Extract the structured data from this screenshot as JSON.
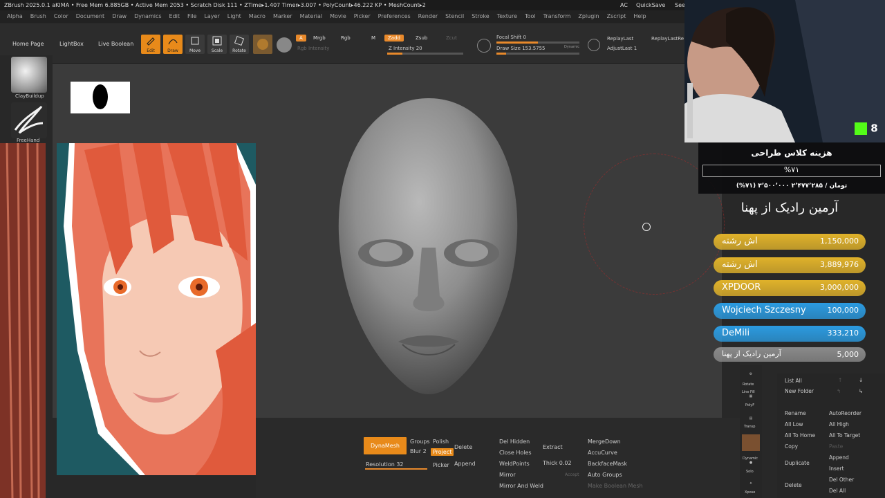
{
  "title_bar": {
    "text": "ZBrush 2025.0.1   aKIMA   • Free Mem 6.885GB • Active Mem 2053 • Scratch Disk 111 • ZTime▸1.407 Timer▸3.007 • PolyCount▸46.222 KP • MeshCount▸2",
    "ac": "AC",
    "quicksave": "QuickSave",
    "see": "See"
  },
  "menu": [
    "Alpha",
    "Brush",
    "Color",
    "Document",
    "Draw",
    "Dynamics",
    "Edit",
    "File",
    "Layer",
    "Light",
    "Macro",
    "Marker",
    "Material",
    "Movie",
    "Picker",
    "Preferences",
    "Render",
    "Stencil",
    "Stroke",
    "Texture",
    "Tool",
    "Transform",
    "Zplugin",
    "Zscript",
    "Help"
  ],
  "toolbar": {
    "home_page": "Home Page",
    "lightbox": "LightBox",
    "live_boolean": "Live Boolean",
    "edit": "Edit",
    "draw": "Draw",
    "move": "Move",
    "scale": "Scale",
    "rotate": "Rotate",
    "a_label": "A",
    "mrgb": "Mrgb",
    "rgb": "Rgb",
    "m_label": "M",
    "rgb_intensity": "Rgb Intensity",
    "zadd": "Zadd",
    "zsub": "Zsub",
    "zcut": "Zcut",
    "z_intensity": "Z Intensity 20",
    "focal_shift": "Focal Shift 0",
    "draw_size": "Draw Size 153.5755",
    "dynamic": "Dynamic",
    "replay_last": "ReplayLast",
    "replay_last_rel": "ReplayLastRe",
    "adjust_last": "AdjustLast 1"
  },
  "progress": {
    "z_intensity": 0.2,
    "focal_shift": 0.5,
    "draw_size": 0.12
  },
  "left_shelf": {
    "brush1": "ClayBuildup",
    "brush2": "FreeHand"
  },
  "bottom_palette": {
    "dynamesh": "DynaMesh",
    "groups": "Groups",
    "polish": "Polish",
    "blur": "Blur 2",
    "project": "Project",
    "resolution": "Resolution 32",
    "picker": "Picker",
    "delete": "Delete",
    "append": "Append",
    "del_hidden": "Del Hidden",
    "close_holes": "Close Holes",
    "weld_points": "WeldPoints",
    "mirror": "Mirror",
    "mirror_and_weld": "Mirror And Weld",
    "extract": "Extract",
    "thick": "Thick 0.02",
    "accept": "Accept",
    "merge_down": "MergeDown",
    "accu_curve": "AccuCurve",
    "backface_mask": "BackfaceMask",
    "auto_groups": "Auto Groups",
    "make_boolean_mesh": "Make Boolean Mesh"
  },
  "right_tray": {
    "rotate": "Rotate",
    "line_fill": "Line Fill",
    "polyf": "PolyF",
    "transp": "Transp",
    "dynamic": "Dynamic",
    "solo": "Solo",
    "xpose": "Xpose"
  },
  "subtool_panel": {
    "list_all": "List All",
    "new_folder": "New Folder",
    "rename": "Rename",
    "auto_reorder": "AutoReorder",
    "all_low": "All Low",
    "all_high": "All High",
    "all_to_home": "All To Home",
    "all_to_target": "All To Target",
    "copy": "Copy",
    "paste": "Paste",
    "duplicate": "Duplicate",
    "append": "Append",
    "insert": "Insert",
    "delete": "Delete",
    "del_other": "Del Other",
    "del_all": "Del All"
  },
  "stream_overlay": {
    "k_badge": "8",
    "goal_title": "هزینه کلاس طراحی",
    "goal_percent": "%۷۱",
    "goal_amount": "(%۷۱) ۳٬۵۰۰٬۰۰۰ تومان / ۲٬۴۷۷٬۲۸۵",
    "top_donor": "آرمین رادیک از پهنا",
    "donations": [
      {
        "name": "اش رشته",
        "amount": "1,150,000",
        "color": "#e0b22a"
      },
      {
        "name": "اش رشته",
        "amount": "3,889,976",
        "color": "#e0b22a"
      },
      {
        "name": "XPDOOR",
        "amount": "3,000,000",
        "color": "#e0b22a"
      },
      {
        "name": "Wojciech Szczesny",
        "amount": "100,000",
        "color": "#2b9be0"
      },
      {
        "name": "DeMili",
        "amount": "333,210",
        "color": "#2b9be0"
      },
      {
        "name": "آرمین رادیک از پهنا",
        "amount": "5,000",
        "color": "#8a8a8a"
      }
    ]
  },
  "colors": {
    "accent": "#e8892b",
    "canvas": "#3b3b3b",
    "panel": "#2a2a2a"
  }
}
